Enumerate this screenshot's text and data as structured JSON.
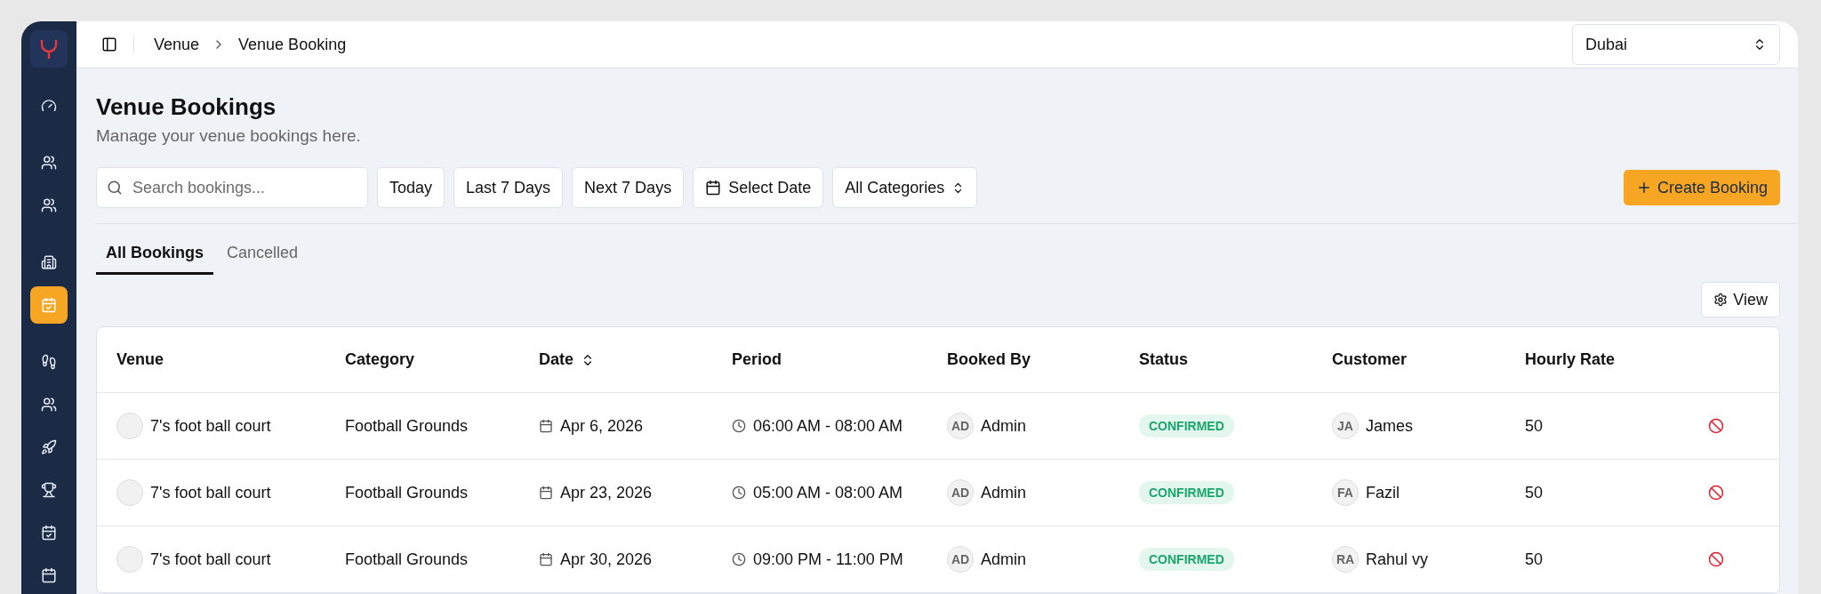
{
  "sidebar": {
    "groups": [
      {
        "items": [
          {
            "kind": "gauge",
            "selected": false
          }
        ]
      },
      {
        "items": [
          {
            "kind": "users",
            "selected": false
          },
          {
            "kind": "users",
            "selected": false
          }
        ]
      },
      {
        "items": [
          {
            "kind": "building",
            "selected": false
          },
          {
            "kind": "calendar-check",
            "selected": true
          }
        ]
      },
      {
        "items": [
          {
            "kind": "runner",
            "selected": false
          },
          {
            "kind": "users",
            "selected": false
          },
          {
            "kind": "rocket",
            "selected": false
          },
          {
            "kind": "trophy",
            "selected": false
          },
          {
            "kind": "calendar-check",
            "selected": false
          },
          {
            "kind": "calendar",
            "selected": false
          }
        ]
      }
    ]
  },
  "breadcrumb": [
    "Venue",
    "Venue Booking"
  ],
  "location_select": {
    "value": "Dubai"
  },
  "page": {
    "title": "Venue Bookings",
    "subtitle": "Manage your venue bookings here."
  },
  "search": {
    "placeholder": "Search bookings..."
  },
  "filters": [
    {
      "label": "Today",
      "kind": "plain"
    },
    {
      "label": "Last 7 Days",
      "kind": "plain"
    },
    {
      "label": "Next 7 Days",
      "kind": "plain"
    },
    {
      "label": "Select Date",
      "kind": "date"
    },
    {
      "label": "All Categories",
      "kind": "select"
    }
  ],
  "create_button": "Create Booking",
  "tabs": [
    {
      "label": "All Bookings",
      "selected": true
    },
    {
      "label": "Cancelled",
      "selected": false
    }
  ],
  "view_button": "View",
  "table": {
    "columns": [
      {
        "label": "Venue",
        "sortable": false
      },
      {
        "label": "Category",
        "sortable": false
      },
      {
        "label": "Date",
        "sortable": true
      },
      {
        "label": "Period",
        "sortable": false
      },
      {
        "label": "Booked By",
        "sortable": false
      },
      {
        "label": "Status",
        "sortable": false
      },
      {
        "label": "Customer",
        "sortable": false
      },
      {
        "label": "Hourly Rate",
        "sortable": false
      }
    ],
    "rows": [
      {
        "venue": "7's foot ball court",
        "category": "Football Grounds",
        "date": "Apr 6, 2026",
        "period": "06:00 AM - 08:00 AM",
        "booked_by_initials": "AD",
        "booked_by": "Admin",
        "status": "CONFIRMED",
        "customer_initials": "JA",
        "customer": "James",
        "hourly_rate": "50"
      },
      {
        "venue": "7's foot ball court",
        "category": "Football Grounds",
        "date": "Apr 23, 2026",
        "period": "05:00 AM - 08:00 AM",
        "booked_by_initials": "AD",
        "booked_by": "Admin",
        "status": "CONFIRMED",
        "customer_initials": "FA",
        "customer": "Fazil",
        "hourly_rate": "50"
      },
      {
        "venue": "7's foot ball court",
        "category": "Football Grounds",
        "date": "Apr 30, 2026",
        "period": "09:00 PM - 11:00 PM",
        "booked_by_initials": "AD",
        "booked_by": "Admin",
        "status": "CONFIRMED",
        "customer_initials": "RA",
        "customer": "Rahul vy",
        "hourly_rate": "50"
      }
    ]
  }
}
